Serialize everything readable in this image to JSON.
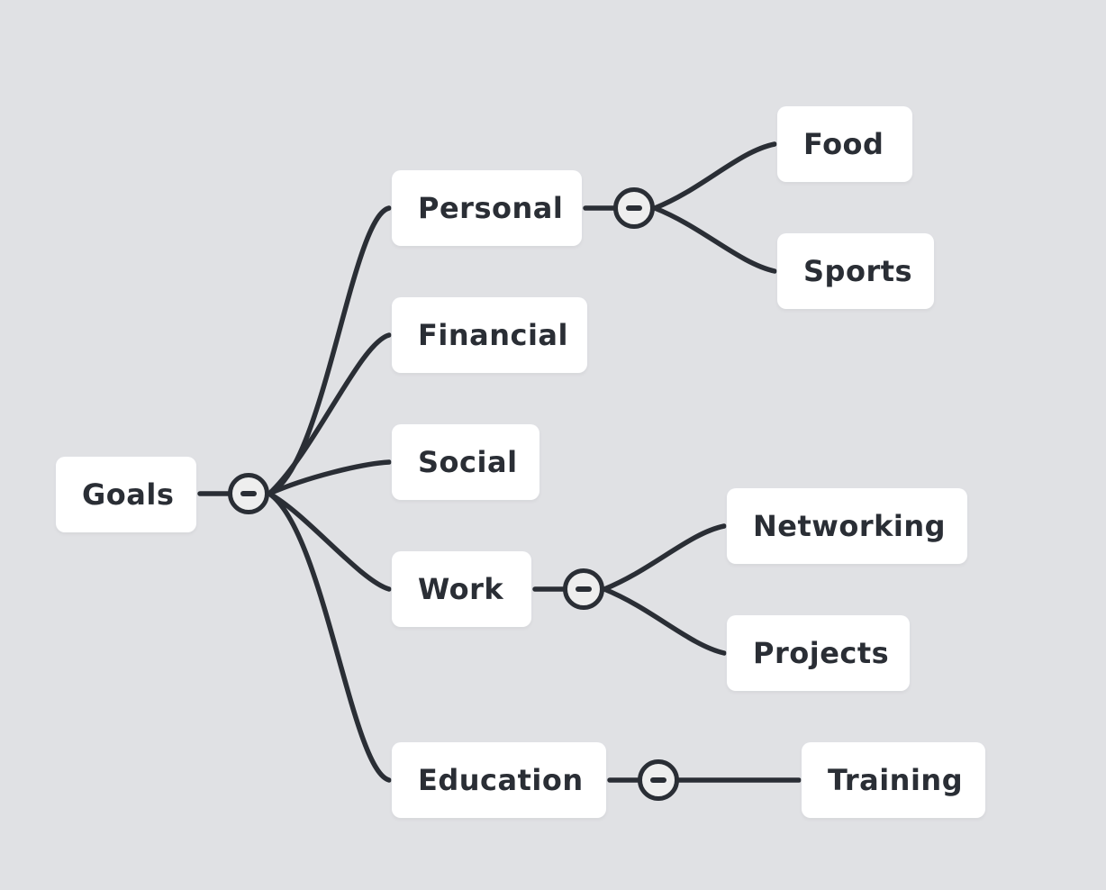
{
  "colors": {
    "background": "#eeeeee",
    "grid_dot": "#e0e1e4",
    "node_fill": "#ffffff",
    "line": "#2a2e35",
    "text": "#2a2e35"
  },
  "mindmap": {
    "root": {
      "label": "Goals",
      "collapsed": false,
      "children": [
        {
          "label": "Personal",
          "collapsed": false,
          "children": [
            {
              "label": "Food"
            },
            {
              "label": "Sports"
            }
          ]
        },
        {
          "label": "Financial"
        },
        {
          "label": "Social"
        },
        {
          "label": "Work",
          "collapsed": false,
          "children": [
            {
              "label": "Networking"
            },
            {
              "label": "Projects"
            }
          ]
        },
        {
          "label": "Education",
          "collapsed": false,
          "children": [
            {
              "label": "Training"
            }
          ]
        }
      ]
    }
  },
  "toggle_icon": "collapse-minus-icon"
}
